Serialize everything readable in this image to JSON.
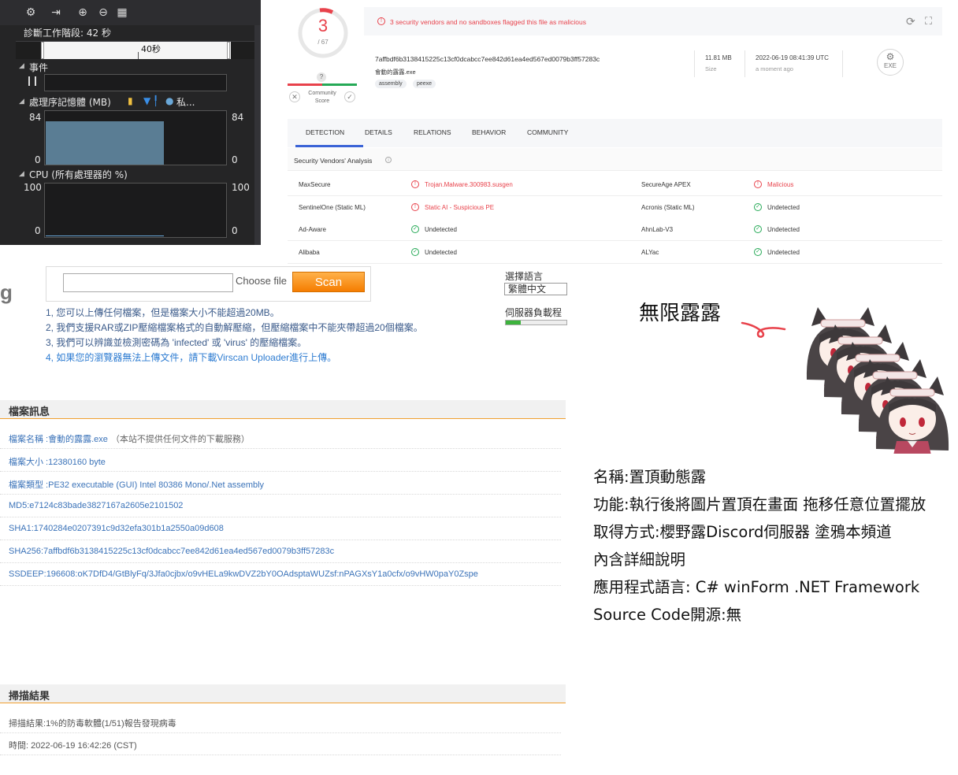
{
  "diagnostics": {
    "toolbar_icons": [
      "gear-icon",
      "export-icon",
      "zoom-in-icon",
      "zoom-out-icon",
      "reset-zoom-icon"
    ],
    "session_label": "診斷工作階段: 42 秒",
    "timeline_label": "40秒",
    "events_label": "事件",
    "memory_title": "處理序記憶體 (MB)",
    "memory_legend_private": "私...",
    "memory_max": "84",
    "memory_min": "0",
    "memory_level": 0.83,
    "cpu_title": "CPU (所有處理器的 %)",
    "cpu_max": "100",
    "cpu_min": "0",
    "colors": {
      "memory_fill": "#5a7d94",
      "legend_gold": "#f0c040",
      "legend_blue": "#3a8ee6",
      "legend_private": "#6aa8d8"
    }
  },
  "virustotal": {
    "score": "3",
    "score_total": "/ 67",
    "community_q": "?",
    "community_label_1": "Community",
    "community_label_2": "Score",
    "alert_text": "3 security vendors and no sandboxes flagged this file as malicious",
    "hash": "7affbdf6b3138415225c13cf0dcabcc7ee842d61ea4ed567ed0079b3ff57283c",
    "file_name": "會動的露露.exe",
    "tags": [
      "assembly",
      "peexe"
    ],
    "size_value": "11.81 MB",
    "size_label": "Size",
    "date_value": "2022-06-19 08:41:39 UTC",
    "date_label": "a moment ago",
    "file_type_badge": "EXE",
    "tabs": [
      "DETECTION",
      "DETAILS",
      "RELATIONS",
      "BEHAVIOR",
      "COMMUNITY"
    ],
    "section_title": "Security Vendors' Analysis",
    "rows": [
      {
        "v1": "MaxSecure",
        "r1": "Trojan.Malware.300983.susgen",
        "s1": "bad",
        "v2": "SecureAge APEX",
        "r2": "Malicious",
        "s2": "bad"
      },
      {
        "v1": "SentinelOne (Static ML)",
        "r1": "Static AI - Suspicious PE",
        "s1": "bad",
        "v2": "Acronis (Static ML)",
        "r2": "Undetected",
        "s2": "ok"
      },
      {
        "v1": "Ad-Aware",
        "r1": "Undetected",
        "s1": "ok",
        "v2": "AhnLab-V3",
        "r2": "Undetected",
        "s2": "ok"
      },
      {
        "v1": "Alibaba",
        "r1": "Undetected",
        "s1": "ok",
        "v2": "ALYac",
        "r2": "Undetected",
        "s2": "ok"
      }
    ],
    "colors": {
      "malicious": "#e8424b",
      "clean": "#25a956",
      "accent": "#3a63d6"
    }
  },
  "upload": {
    "logo_fragment": "g",
    "choose_label": "Choose file",
    "scan_label": "Scan",
    "tips": [
      "1, 您可以上傳任何檔案，但是檔案大小不能超過20MB。",
      "2, 我們支援RAR或ZIP壓縮檔案格式的自動解壓縮，但壓縮檔案中不能夾帶超過20個檔案。",
      "3, 我們可以辨識並檢測密碼為 'infected' 或 'virus' 的壓縮檔案。"
    ],
    "tip4_prefix": "4, 如果您的瀏覽器無法上傳文件，",
    "tip4_link": "請下載Virscan Uploader進行上傳。",
    "language_label": "選擇語言",
    "language_value": "繁體中文",
    "server_load_label": "伺服器負載程",
    "server_load": 0.25
  },
  "file_info": {
    "title": "檔案訊息",
    "rows": [
      {
        "label": "檔案名稱 :",
        "value": "會動的露露.exe",
        "note": "（本站不提供任何文件的下載服務）"
      },
      {
        "label": "檔案大小 :",
        "value": "12380160 byte",
        "note": ""
      },
      {
        "label": "檔案類型 :",
        "value": "PE32 executable (GUI) Intel 80386 Mono/.Net assembly",
        "note": ""
      },
      {
        "label": "MD5:",
        "value": "e7124c83bade3827167a2605e2101502",
        "note": ""
      },
      {
        "label": "SHA1:",
        "value": "1740284e0207391c9d32efa301b1a2550a09d608",
        "note": ""
      },
      {
        "label": "SHA256:",
        "value": "7affbdf6b3138415225c13cf0dcabcc7ee842d61ea4ed567ed0079b3ff57283c",
        "note": ""
      },
      {
        "label": "SSDEEP:",
        "value": "196608:oK7DfD4/GtBlyFq/3Jfa0cjbx/o9vHELa9kwDVZ2bY0OAdsptaWUZsf:nPAGXsY1a0cfx/o9vHW0paY0Zspe",
        "note": ""
      }
    ]
  },
  "scan_results": {
    "title": "掃描結果",
    "result_label": "掃描結果:",
    "result_value": "1%的防毒軟體(1/51)報告發現病毒",
    "time_label": "時間:",
    "time_value": "2022-06-19 16:42:26 (CST)"
  },
  "app_info": {
    "title": "無限露露",
    "lines": [
      "名稱:置頂動態露",
      "功能:執行後將圖片置頂在畫面 拖移任意位置擺放",
      "取得方式:櫻野露Discord伺服器 塗鴉本頻道",
      "內含詳細說明",
      "應用程式語言: C# winForm .NET Framework",
      "Source Code開源:無"
    ]
  }
}
